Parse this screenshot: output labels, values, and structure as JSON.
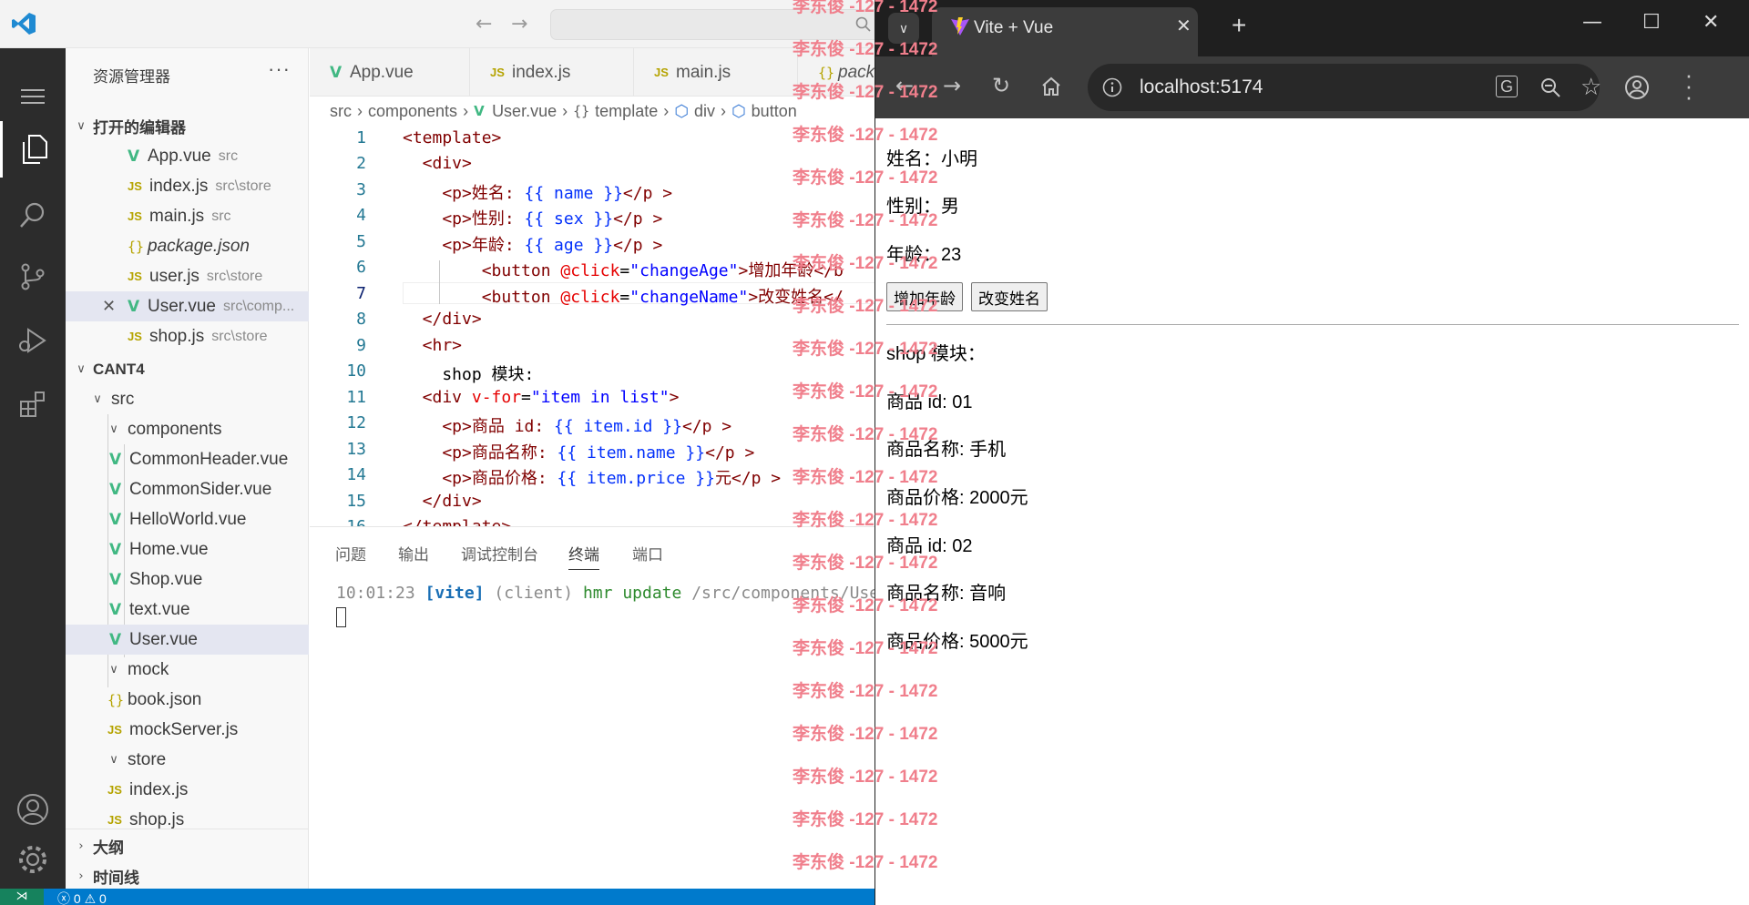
{
  "vscode": {
    "explorer_title": "资源管理器",
    "open_editors_label": "打开的编辑器",
    "open_editors": [
      {
        "type": "vue",
        "name": "App.vue",
        "desc": "src"
      },
      {
        "type": "js",
        "name": "index.js",
        "desc": "src\\store"
      },
      {
        "type": "js",
        "name": "main.js",
        "desc": "src"
      },
      {
        "type": "json",
        "name": "package.json",
        "desc": ""
      },
      {
        "type": "js",
        "name": "user.js",
        "desc": "src\\store"
      },
      {
        "type": "vue",
        "name": "User.vue",
        "desc": "src\\comp..."
      },
      {
        "type": "js",
        "name": "shop.js",
        "desc": "src\\store"
      }
    ],
    "project_label": "CANT4",
    "tree": {
      "src": "src",
      "components": "components",
      "component_files": [
        "CommonHeader.vue",
        "CommonSider.vue",
        "HelloWorld.vue",
        "Home.vue",
        "Shop.vue",
        "text.vue",
        "User.vue"
      ],
      "mock": "mock",
      "mock_files": [
        {
          "type": "json",
          "name": "book.json"
        },
        {
          "type": "js",
          "name": "mockServer.js"
        }
      ],
      "store": "store",
      "store_files": [
        "index.js",
        "shop.js"
      ]
    },
    "outline_label": "大纲",
    "timeline_label": "时间线",
    "tabs": [
      {
        "type": "vue",
        "name": "App.vue"
      },
      {
        "type": "js",
        "name": "index.js"
      },
      {
        "type": "js",
        "name": "main.js"
      },
      {
        "type": "json",
        "name": "pack"
      }
    ],
    "breadcrumb": [
      "src",
      "components",
      "User.vue",
      "template",
      "div",
      "button"
    ],
    "line_numbers": [
      "1",
      "2",
      "3",
      "4",
      "5",
      "6",
      "7",
      "8",
      "9",
      "10",
      "11",
      "12",
      "13",
      "14",
      "15",
      "16"
    ],
    "code": {
      "l1": "<template>",
      "l2": "  <div>",
      "l3a": "    <p>姓名: ",
      "l3b": "{{ name }}",
      "l3c": "</p >",
      "l4a": "    <p>性别: ",
      "l4b": "{{ sex }}",
      "l4c": "</p >",
      "l5a": "    <p>年龄: ",
      "l5b": "{{ age }}",
      "l5c": "</p >",
      "l6a": "        <button ",
      "l6b": "@click",
      "l6c": "=",
      "l6d": "\"changeAge\"",
      "l6e": ">增加年龄</b",
      "l7a": "        <button ",
      "l7b": "@click",
      "l7c": "=",
      "l7d": "\"changeName\"",
      "l7e": ">改变姓名</",
      "l8": "  </div>",
      "l9": "  <hr>",
      "l10": "    shop 模块:",
      "l11a": "  <div ",
      "l11b": "v-for",
      "l11c": "=",
      "l11d": "\"item in list\"",
      "l11e": ">",
      "l12a": "    <p>商品 id: ",
      "l12b": "{{ item.id }}",
      "l12c": "</p >",
      "l13a": "    <p>商品名称: ",
      "l13b": "{{ item.name }}",
      "l13c": "</p >",
      "l14a": "    <p>商品价格: ",
      "l14b": "{{ item.price }}",
      "l14c": "元</p >",
      "l15": "  </div>",
      "l16": "</template>"
    },
    "panel_tabs": [
      "问题",
      "输出",
      "调试控制台",
      "终端",
      "端口"
    ],
    "terminal": {
      "time": "10:01:23",
      "tag": "[vite]",
      "client": "(client)",
      "hmr": "hmr update",
      "path": "/src/components/User.vue"
    },
    "status": {
      "errors": "0",
      "warnings": "0"
    }
  },
  "browser": {
    "tab_title": "Vite + Vue",
    "url": "localhost:5174",
    "name_line": "姓名：小明",
    "sex_line": "性别：男",
    "age_line": "年龄：23",
    "btn_age": "增加年龄",
    "btn_name": "改变姓名",
    "shop_title": "shop 模块：",
    "items": [
      {
        "id": "商品 id: 01",
        "name": "商品名称: 手机",
        "price": "商品价格: 2000元"
      },
      {
        "id": "商品 id: 02",
        "name": "商品名称: 音响",
        "price": "商品价格: 5000元"
      }
    ]
  },
  "watermark": "李东俊 -127 - 1472",
  "colors": {
    "vue_green": "#41b883",
    "js_yellow": "#b5a300",
    "status_blue": "#007acc",
    "watermark": "#f07f8c"
  }
}
